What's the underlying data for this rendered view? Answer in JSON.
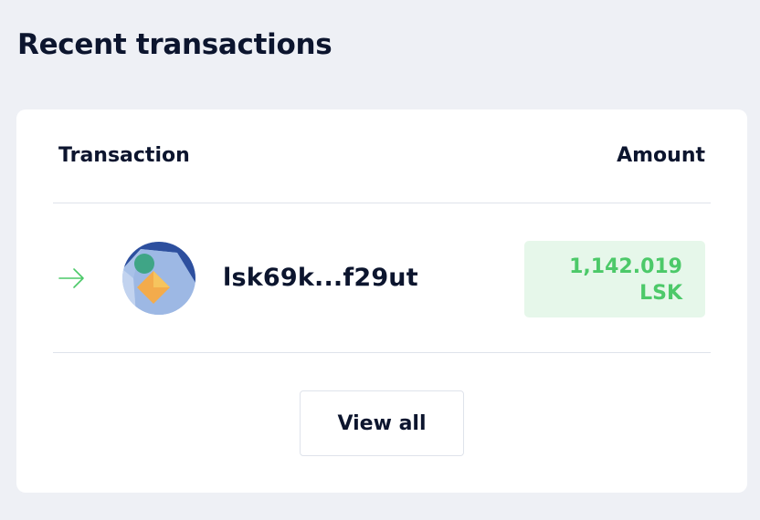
{
  "page": {
    "title": "Recent transactions"
  },
  "table": {
    "columns": {
      "transaction": "Transaction",
      "amount": "Amount"
    },
    "rows": [
      {
        "direction_icon": "arrow-right-icon",
        "address": "lsk69k...f29ut",
        "amount": "1,142.019",
        "token": "LSK"
      }
    ]
  },
  "actions": {
    "view_all": "View all"
  },
  "colors": {
    "background": "#eef0f5",
    "card": "#ffffff",
    "text": "#0c152e",
    "incoming": "#4cc969",
    "incoming_bg": "#e6f7ea",
    "divider": "#dfe3eb"
  }
}
